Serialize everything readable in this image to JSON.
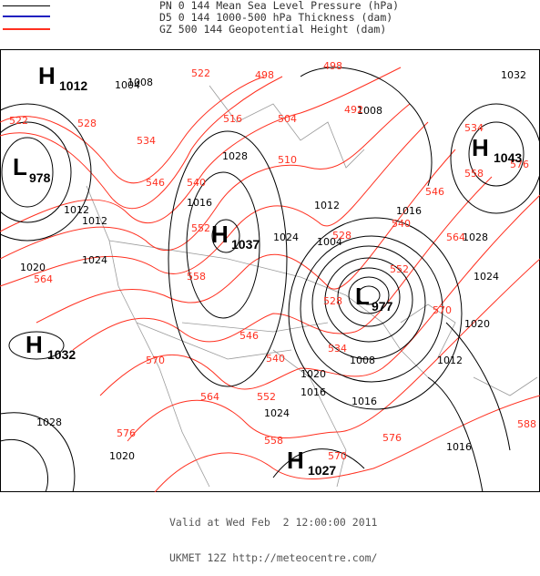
{
  "legend": [
    {
      "text": "PN 0 144 Mean Sea Level Pressure (hPa)",
      "color": "#000000"
    },
    {
      "text": "D5 0 144 1000-500 hPa Thickness (dam)",
      "color": "#2020c0"
    },
    {
      "text": "GZ 500 144 Geopotential Height (dam)",
      "color": "#ff3020"
    }
  ],
  "centers": [
    {
      "type": "H",
      "value": "1012"
    },
    {
      "type": "L",
      "value": "978"
    },
    {
      "type": "H",
      "value": "1037"
    },
    {
      "type": "H",
      "value": "1043"
    },
    {
      "type": "L",
      "value": "977"
    },
    {
      "type": "H",
      "value": "1032"
    },
    {
      "type": "H",
      "value": "1027"
    }
  ],
  "pressure_labels": [
    "1004",
    "1008",
    "1012",
    "1016",
    "1020",
    "1024",
    "1028",
    "1032",
    "1012",
    "1016",
    "1028",
    "1024",
    "1020",
    "1024",
    "1016",
    "1004",
    "1008",
    "1016",
    "1012",
    "1020",
    "1024",
    "1020",
    "1028",
    "1012",
    "1008",
    "1016"
  ],
  "height_labels": [
    "498",
    "492",
    "498",
    "504",
    "510",
    "516",
    "522",
    "522",
    "528",
    "534",
    "540",
    "546",
    "552",
    "558",
    "564",
    "570",
    "576",
    "552",
    "558",
    "546",
    "540",
    "534",
    "528",
    "564",
    "558",
    "576",
    "570",
    "564",
    "552",
    "540",
    "546",
    "528",
    "534",
    "576",
    "588",
    "570"
  ],
  "footer": {
    "valid": "Valid at Wed Feb  2 12:00:00 2011",
    "source": "UKMET 12Z http://meteocentre.com/"
  },
  "colors": {
    "pressure": "#000000",
    "height": "#ff3020",
    "coast": "#9a9a9a"
  }
}
